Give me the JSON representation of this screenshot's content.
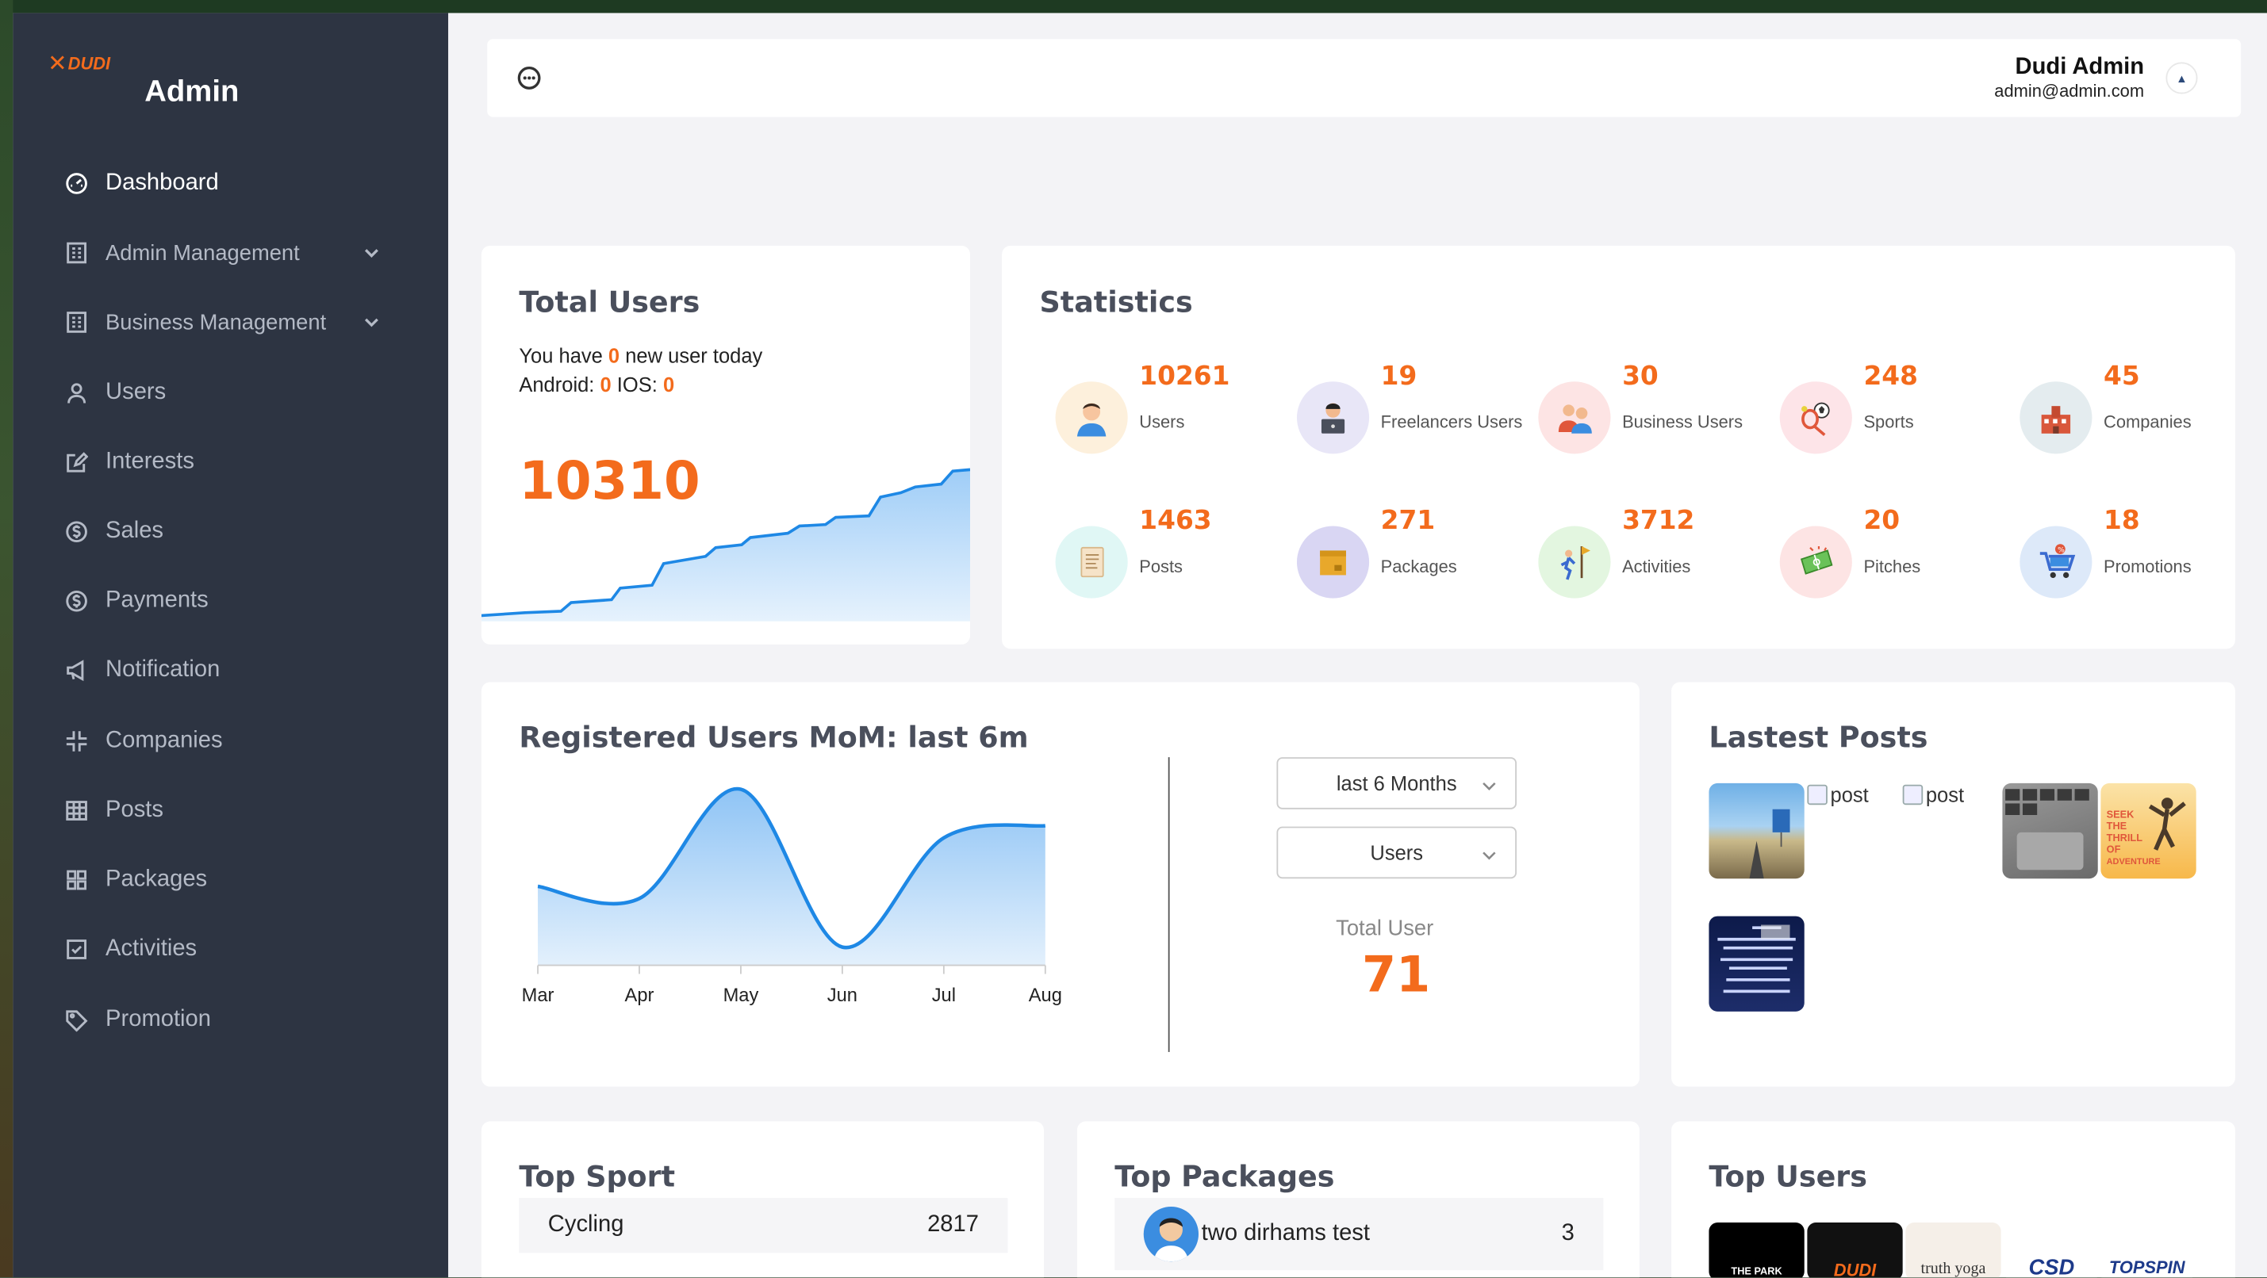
{
  "sidebar": {
    "brand_logo_text": "DUDI",
    "title": "Admin",
    "items": [
      {
        "label": "Dashboard",
        "icon": "dashboard-icon"
      },
      {
        "label": "Admin Management",
        "icon": "building-icon"
      },
      {
        "label": "Business Management",
        "icon": "building-icon"
      },
      {
        "label": "Users",
        "icon": "user-icon"
      },
      {
        "label": "Interests",
        "icon": "edit-icon"
      },
      {
        "label": "Sales",
        "icon": "dollar-icon"
      },
      {
        "label": "Payments",
        "icon": "dollar-icon"
      },
      {
        "label": "Notification",
        "icon": "megaphone-icon"
      },
      {
        "label": "Companies",
        "icon": "compress-icon"
      },
      {
        "label": "Posts",
        "icon": "table-icon"
      },
      {
        "label": "Packages",
        "icon": "grid-icon"
      },
      {
        "label": "Activities",
        "icon": "calendar-check-icon"
      },
      {
        "label": "Promotion",
        "icon": "tag-icon"
      }
    ]
  },
  "header": {
    "user_name": "Dudi Admin",
    "user_email": "admin@admin.com"
  },
  "total_users": {
    "title": "Total Users",
    "line1_prefix": "You have ",
    "new_today": "0",
    "line1_suffix": " new user today",
    "android_label": "Android: ",
    "android": "0",
    "ios_label": " IOS: ",
    "ios": "0",
    "total": "10310"
  },
  "statistics": {
    "title": "Statistics",
    "items": [
      {
        "value": "10261",
        "label": "Users",
        "icon": "user-avatar-icon",
        "bg": "#fdf0dc"
      },
      {
        "value": "19",
        "label": "Freelancers Users",
        "icon": "freelancer-laptop-icon",
        "bg": "#e8e6f7"
      },
      {
        "value": "30",
        "label": "Business Users",
        "icon": "business-users-icon",
        "bg": "#fde4e4"
      },
      {
        "value": "248",
        "label": "Sports",
        "icon": "sports-icon",
        "bg": "#fde4e8"
      },
      {
        "value": "45",
        "label": "Companies",
        "icon": "company-building-icon",
        "bg": "#e4ecef"
      },
      {
        "value": "1463",
        "label": "Posts",
        "icon": "post-document-icon",
        "bg": "#e0f7f5"
      },
      {
        "value": "271",
        "label": "Packages",
        "icon": "package-box-icon",
        "bg": "#d9d6f3"
      },
      {
        "value": "3712",
        "label": "Activities",
        "icon": "climber-flag-icon",
        "bg": "#e3f6e0"
      },
      {
        "value": "20",
        "label": "Pitches",
        "icon": "pitch-field-icon",
        "bg": "#fde4e4"
      },
      {
        "value": "18",
        "label": "Promotions",
        "icon": "shopping-cart-icon",
        "bg": "#dde9f9"
      }
    ]
  },
  "registered": {
    "title": "Registered Users MoM: last 6m",
    "period_select": "last 6 Months",
    "type_select": "Users",
    "total_label": "Total User",
    "total_value": "71"
  },
  "chart_data": {
    "type": "area",
    "categories": [
      "Mar",
      "Apr",
      "May",
      "Jun",
      "Jul",
      "Aug"
    ],
    "values": [
      13,
      11,
      29,
      3,
      21,
      23
    ],
    "title": "Registered Users MoM: last 6m",
    "xlabel": "",
    "ylabel": "",
    "ylim": [
      0,
      30
    ],
    "grid": false,
    "color": "#1e88e5"
  },
  "latest_posts": {
    "title": "Lastest Posts",
    "broken_alt": "post"
  },
  "top_sport": {
    "title": "Top Sport",
    "rows": [
      {
        "name": "Cycling",
        "count": "2817"
      }
    ]
  },
  "top_packages": {
    "title": "Top Packages",
    "rows": [
      {
        "name": "two dirhams test",
        "count": "3"
      }
    ]
  },
  "top_users": {
    "title": "Top Users",
    "logos": [
      "THE PARK",
      "DUDI",
      "truth yoga",
      "CSD",
      "TOPSPIN"
    ]
  },
  "colors": {
    "accent": "#f36b1c",
    "sidebar_bg": "#2d3442",
    "chart_blue": "#1e88e5"
  }
}
